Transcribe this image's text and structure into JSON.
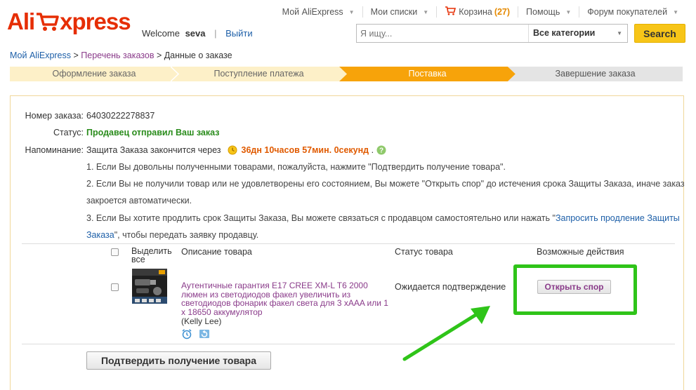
{
  "header": {
    "logo_left": "Ali",
    "logo_right": "xpress",
    "welcome": "Welcome",
    "username": "seva",
    "separator": "|",
    "logout": "Выйти"
  },
  "topnav": {
    "my_aliexpress": "Мой AliExpress",
    "my_lists": "Мои списки",
    "cart": "Корзина",
    "cart_count": "(27)",
    "help": "Помощь",
    "forum": "Форум покупателей"
  },
  "search": {
    "placeholder": "Я ищу...",
    "category": "Все категории",
    "button": "Search"
  },
  "breadcrumb": {
    "item1": "Мой AliExpress",
    "sep": " > ",
    "item2": "Перечень заказов",
    "item3": "Данные о заказе"
  },
  "steps": [
    {
      "label": "Оформление заказа",
      "state": "done"
    },
    {
      "label": "Поступление платежа",
      "state": "done"
    },
    {
      "label": "Поставка",
      "state": "active"
    },
    {
      "label": "Завершение заказа",
      "state": "pending"
    }
  ],
  "order": {
    "number_label": "Номер заказа:",
    "number_value": "64030222278837",
    "status_label": "Статус:",
    "status_value": "Продавец отправил Ваш заказ",
    "reminder_label": "Напоминание:",
    "reminder_text": "Защита Заказа закончится через",
    "timer": "36дн 10часов 57мин. 0секунд",
    "reminder_end": ".",
    "note1": "1. Если Вы довольны полученными товарами, пожалуйста, нажмите \"Подтвердить получение товара\".",
    "note2a": "2. Если Вы не получили товар или не удовлетворены его состоянием, Вы можете \"Открыть спор\" до истечения срока Защиты Заказа, иначе заказ",
    "note2b": "закроется автоматически.",
    "note3a": "3. Если Вы хотите продлить срок Защиты Заказа, Вы можете связаться с продавцом самостоятельно или нажать \"",
    "note3_link1": "Запросить продление Защиты",
    "note3_link2": "Заказа",
    "note3_end": "\", чтобы передать заявку продавцу."
  },
  "table": {
    "select_all": "Выделить все",
    "select_all_1": "Выделить",
    "select_all_2": "все",
    "description": "Описание товара",
    "status": "Статус товара",
    "actions": "Возможные действия"
  },
  "product": {
    "title": "Аутентичные гарантия E17 CREE XM-L T6 2000 люмен из светодиодов факел увеличить из светодиодов фонарик факел света для 3 хAAA или 1 x 18650 аккумулятор",
    "seller": "(Kelly Lee)",
    "status": "Ожидается подтверждение",
    "action_button": "Открыть спор"
  },
  "confirm_button": "Подтвердить получение товара",
  "colors": {
    "brand_red": "#e62e04",
    "step_done": "#fdf0c8",
    "step_active": "#f7a30a",
    "step_pending": "#e4e4e4",
    "highlight_green": "#2fc419"
  }
}
